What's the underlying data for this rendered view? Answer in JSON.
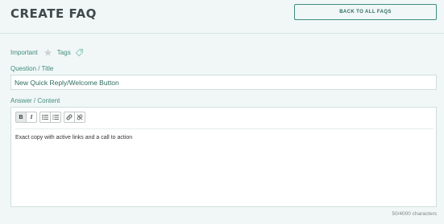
{
  "header": {
    "title": "CREATE FAQ",
    "back_button_label": "BACK TO ALL FAQS"
  },
  "meta": {
    "important_label": "Important",
    "tags_label": "Tags"
  },
  "question": {
    "label": "Question / Title",
    "value": "New Quick Reply/Welcome Button"
  },
  "answer": {
    "label": "Answer / Content",
    "content": "Exact copy with active links and a call to action",
    "toolbar": {
      "bold_label": "B",
      "italic_label": "I",
      "icons": [
        "bulleted-list-icon",
        "numbered-list-icon",
        "link-icon",
        "unlink-icon"
      ]
    }
  },
  "char_count": "50/4000 characters",
  "colors": {
    "background": "#f1f7f6",
    "accent": "#3e8e7e",
    "title": "#3f4a4a"
  }
}
